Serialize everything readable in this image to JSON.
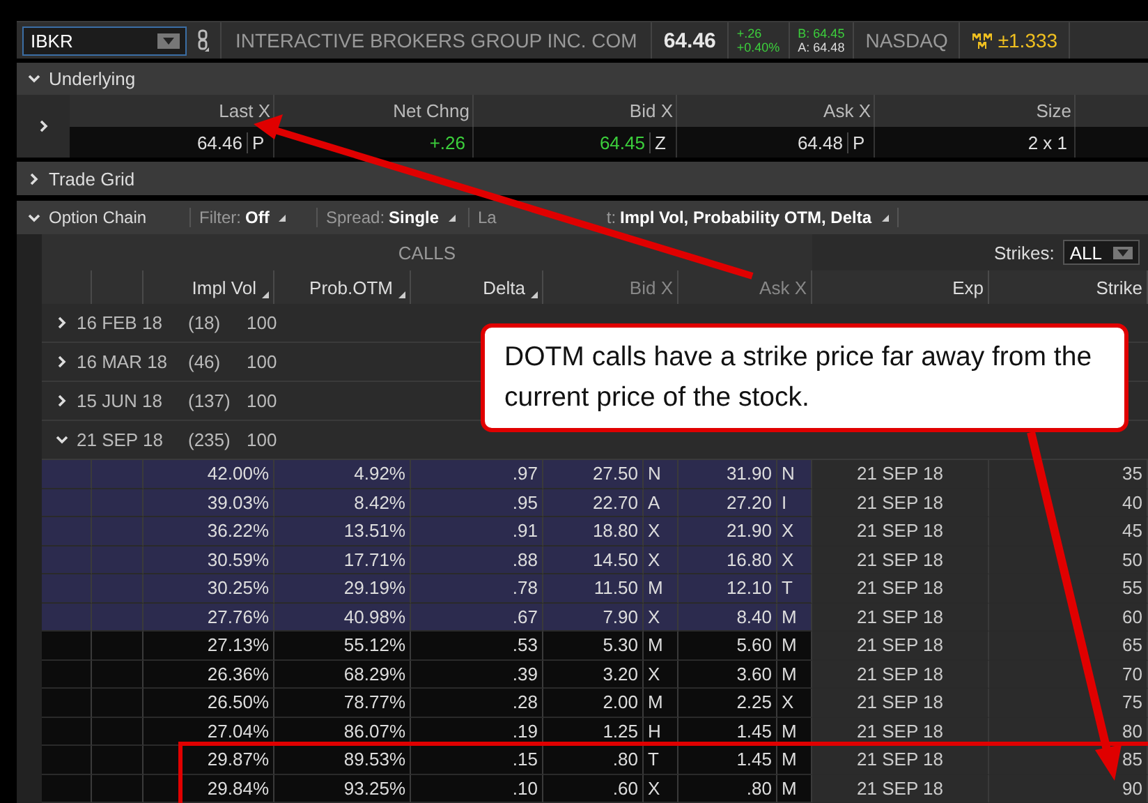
{
  "symbol_bar": {
    "symbol": "IBKR",
    "company": "INTERACTIVE BROKERS GROUP INC. COM",
    "last": "64.46",
    "net_change": "+.26",
    "percent_change": "+0.40%",
    "bid": "B: 64.45",
    "ask": "A: 64.48",
    "exchange": "NASDAQ",
    "expected_move": "±1.333"
  },
  "underlying": {
    "title": "Underlying",
    "expanded": true,
    "columns": [
      "Last X",
      "Net Chng",
      "Bid X",
      "Ask X",
      "Size"
    ],
    "values": [
      {
        "value": "64.46",
        "exchange": "P",
        "color": "#e0e0e0"
      },
      {
        "value": "+.26",
        "color": "#3ccf3c"
      },
      {
        "value": "64.45",
        "exchange": "Z",
        "color": "#3ccf3c"
      },
      {
        "value": "64.48",
        "exchange": "P",
        "color": "#e0e0e0"
      },
      {
        "value": "2 x 1",
        "color": "#e0e0e0"
      }
    ]
  },
  "trade_grid": {
    "title": "Trade Grid",
    "expanded": false
  },
  "option_chain": {
    "title": "Option Chain",
    "expanded": true,
    "filter_label": "Filter:",
    "filter_value": "Off",
    "spread_label": "Spread:",
    "spread_value": "Single",
    "layout_label_start": "La",
    "layout_label_end": "t:",
    "layout_value": "Impl Vol, Probability OTM, Delta",
    "side": "CALLS",
    "strikes_label": "Strikes:",
    "strikes_value": "ALL",
    "columns": [
      "Impl Vol",
      "Prob.OTM",
      "Delta",
      "Bid X",
      "Ask X",
      "Exp",
      "Strike"
    ],
    "expirations": [
      {
        "label": "16 FEB 18",
        "count": "(18)",
        "multiplier": "100",
        "expanded": false
      },
      {
        "label": "16 MAR 18",
        "count": "(46)",
        "multiplier": "100",
        "expanded": false
      },
      {
        "label": "15 JUN 18",
        "count": "(137)",
        "multiplier": "100",
        "expanded": false
      },
      {
        "label": "21 SEP 18",
        "count": "(235)",
        "multiplier": "100",
        "expanded": true
      }
    ],
    "rows": [
      {
        "impl_vol": "42.00%",
        "prob_otm": "4.92%",
        "delta": ".97",
        "bid": "27.50",
        "bid_exchange": "N",
        "ask": "31.90",
        "ask_exchange": "N",
        "exp": "21 SEP 18",
        "strike": "35",
        "in_the_money": true
      },
      {
        "impl_vol": "39.03%",
        "prob_otm": "8.42%",
        "delta": ".95",
        "bid": "22.70",
        "bid_exchange": "A",
        "ask": "27.20",
        "ask_exchange": "I",
        "exp": "21 SEP 18",
        "strike": "40",
        "in_the_money": true
      },
      {
        "impl_vol": "36.22%",
        "prob_otm": "13.51%",
        "delta": ".91",
        "bid": "18.80",
        "bid_exchange": "X",
        "ask": "21.90",
        "ask_exchange": "X",
        "exp": "21 SEP 18",
        "strike": "45",
        "in_the_money": true
      },
      {
        "impl_vol": "30.59%",
        "prob_otm": "17.71%",
        "delta": ".88",
        "bid": "14.50",
        "bid_exchange": "X",
        "ask": "16.80",
        "ask_exchange": "X",
        "exp": "21 SEP 18",
        "strike": "50",
        "in_the_money": true
      },
      {
        "impl_vol": "30.25%",
        "prob_otm": "29.19%",
        "delta": ".78",
        "bid": "11.50",
        "bid_exchange": "M",
        "ask": "12.10",
        "ask_exchange": "T",
        "exp": "21 SEP 18",
        "strike": "55",
        "in_the_money": true
      },
      {
        "impl_vol": "27.76%",
        "prob_otm": "40.98%",
        "delta": ".67",
        "bid": "7.90",
        "bid_exchange": "X",
        "ask": "8.40",
        "ask_exchange": "M",
        "exp": "21 SEP 18",
        "strike": "60",
        "in_the_money": true
      },
      {
        "impl_vol": "27.13%",
        "prob_otm": "55.12%",
        "delta": ".53",
        "bid": "5.30",
        "bid_exchange": "M",
        "ask": "5.60",
        "ask_exchange": "M",
        "exp": "21 SEP 18",
        "strike": "65",
        "in_the_money": false
      },
      {
        "impl_vol": "26.36%",
        "prob_otm": "68.29%",
        "delta": ".39",
        "bid": "3.20",
        "bid_exchange": "X",
        "ask": "3.60",
        "ask_exchange": "M",
        "exp": "21 SEP 18",
        "strike": "70",
        "in_the_money": false
      },
      {
        "impl_vol": "26.50%",
        "prob_otm": "78.77%",
        "delta": ".28",
        "bid": "2.00",
        "bid_exchange": "M",
        "ask": "2.25",
        "ask_exchange": "X",
        "exp": "21 SEP 18",
        "strike": "75",
        "in_the_money": false
      },
      {
        "impl_vol": "27.04%",
        "prob_otm": "86.07%",
        "delta": ".19",
        "bid": "1.25",
        "bid_exchange": "H",
        "ask": "1.45",
        "ask_exchange": "M",
        "exp": "21 SEP 18",
        "strike": "80",
        "in_the_money": false
      },
      {
        "impl_vol": "29.87%",
        "prob_otm": "89.53%",
        "delta": ".15",
        "bid": ".80",
        "bid_exchange": "T",
        "ask": "1.45",
        "ask_exchange": "M",
        "exp": "21 SEP 18",
        "strike": "85",
        "in_the_money": false
      },
      {
        "impl_vol": "29.84%",
        "prob_otm": "93.25%",
        "delta": ".10",
        "bid": ".60",
        "bid_exchange": "X",
        "ask": ".80",
        "ask_exchange": "M",
        "exp": "21 SEP 18",
        "strike": "90",
        "in_the_money": false
      }
    ]
  },
  "annotation": {
    "callout": "DOTM calls have a strike price far away from the current price of the stock."
  }
}
